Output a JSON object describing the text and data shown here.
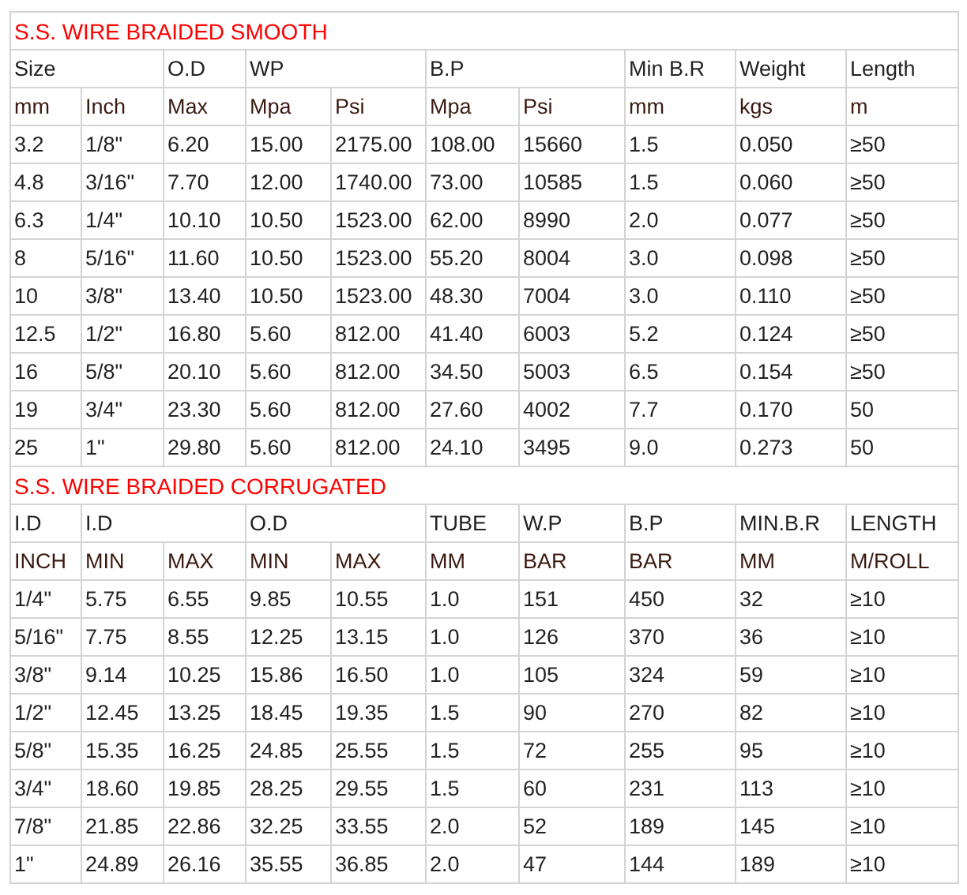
{
  "sections": [
    {
      "title": "S.S. WIRE BRAIDED SMOOTH",
      "column_groups": [
        {
          "label": "Size",
          "units": [
            "mm",
            "Inch"
          ]
        },
        {
          "label": "O.D",
          "units": [
            "Max"
          ]
        },
        {
          "label": "WP",
          "units": [
            "Mpa",
            "Psi"
          ]
        },
        {
          "label": "B.P",
          "units": [
            "Mpa",
            "Psi"
          ]
        },
        {
          "label": "Min B.R",
          "units": [
            "mm"
          ]
        },
        {
          "label": "Weight",
          "units": [
            "kgs"
          ]
        },
        {
          "label": "Length",
          "units": [
            "m"
          ]
        }
      ],
      "rows": [
        [
          "3.2",
          "1/8\"",
          "6.20",
          "15.00",
          "2175.00",
          "108.00",
          "15660",
          "1.5",
          "0.050",
          "≥50"
        ],
        [
          "4.8",
          "3/16\"",
          "7.70",
          "12.00",
          "1740.00",
          "73.00",
          "10585",
          "1.5",
          "0.060",
          "≥50"
        ],
        [
          "6.3",
          "1/4\"",
          "10.10",
          "10.50",
          "1523.00",
          "62.00",
          "8990",
          "2.0",
          "0.077",
          "≥50"
        ],
        [
          "8",
          "5/16\"",
          "11.60",
          "10.50",
          "1523.00",
          "55.20",
          "8004",
          "3.0",
          "0.098",
          "≥50"
        ],
        [
          "10",
          "3/8\"",
          "13.40",
          "10.50",
          "1523.00",
          "48.30",
          "7004",
          "3.0",
          "0.110",
          "≥50"
        ],
        [
          "12.5",
          "1/2\"",
          "16.80",
          "5.60",
          "812.00",
          "41.40",
          "6003",
          "5.2",
          "0.124",
          "≥50"
        ],
        [
          "16",
          "5/8\"",
          "20.10",
          "5.60",
          "812.00",
          "34.50",
          "5003",
          "6.5",
          "0.154",
          "≥50"
        ],
        [
          "19",
          "3/4\"",
          "23.30",
          "5.60",
          "812.00",
          "27.60",
          "4002",
          "7.7",
          "0.170",
          "50"
        ],
        [
          "25",
          "1\"",
          "29.80",
          "5.60",
          "812.00",
          "24.10",
          "3495",
          "9.0",
          "0.273",
          "50"
        ]
      ]
    },
    {
      "title": "S.S. WIRE BRAIDED CORRUGATED",
      "column_groups": [
        {
          "label": "I.D",
          "units": [
            "INCH"
          ]
        },
        {
          "label": "I.D",
          "units": [
            "MIN",
            "MAX"
          ]
        },
        {
          "label": "O.D",
          "units": [
            "MIN",
            "MAX"
          ]
        },
        {
          "label": "TUBE",
          "units": [
            "MM"
          ]
        },
        {
          "label": "W.P",
          "units": [
            "BAR"
          ]
        },
        {
          "label": "B.P",
          "units": [
            "BAR"
          ]
        },
        {
          "label": "MIN.B.R",
          "units": [
            "MM"
          ]
        },
        {
          "label": "LENGTH",
          "units": [
            "M/ROLL"
          ]
        }
      ],
      "rows": [
        [
          "1/4\"",
          "5.75",
          "6.55",
          "9.85",
          "10.55",
          "1.0",
          "151",
          "450",
          "32",
          "≥10"
        ],
        [
          "5/16\"",
          "7.75",
          "8.55",
          "12.25",
          "13.15",
          "1.0",
          "126",
          "370",
          "36",
          "≥10"
        ],
        [
          "3/8\"",
          "9.14",
          "10.25",
          "15.86",
          "16.50",
          "1.0",
          "105",
          "324",
          "59",
          "≥10"
        ],
        [
          "1/2\"",
          "12.45",
          "13.25",
          "18.45",
          "19.35",
          "1.5",
          "90",
          "270",
          "82",
          "≥10"
        ],
        [
          "5/8\"",
          "15.35",
          "16.25",
          "24.85",
          "25.55",
          "1.5",
          "72",
          "255",
          "95",
          "≥10"
        ],
        [
          "3/4\"",
          "18.60",
          "19.85",
          "28.25",
          "29.55",
          "1.5",
          "60",
          "231",
          "113",
          "≥10"
        ],
        [
          "7/8\"",
          "21.85",
          "22.86",
          "32.25",
          "33.55",
          "2.0",
          "52",
          "189",
          "145",
          "≥10"
        ],
        [
          "1\"",
          "24.89",
          "26.16",
          "35.55",
          "36.85",
          "2.0",
          "47",
          "144",
          "189",
          "≥10"
        ]
      ]
    }
  ]
}
